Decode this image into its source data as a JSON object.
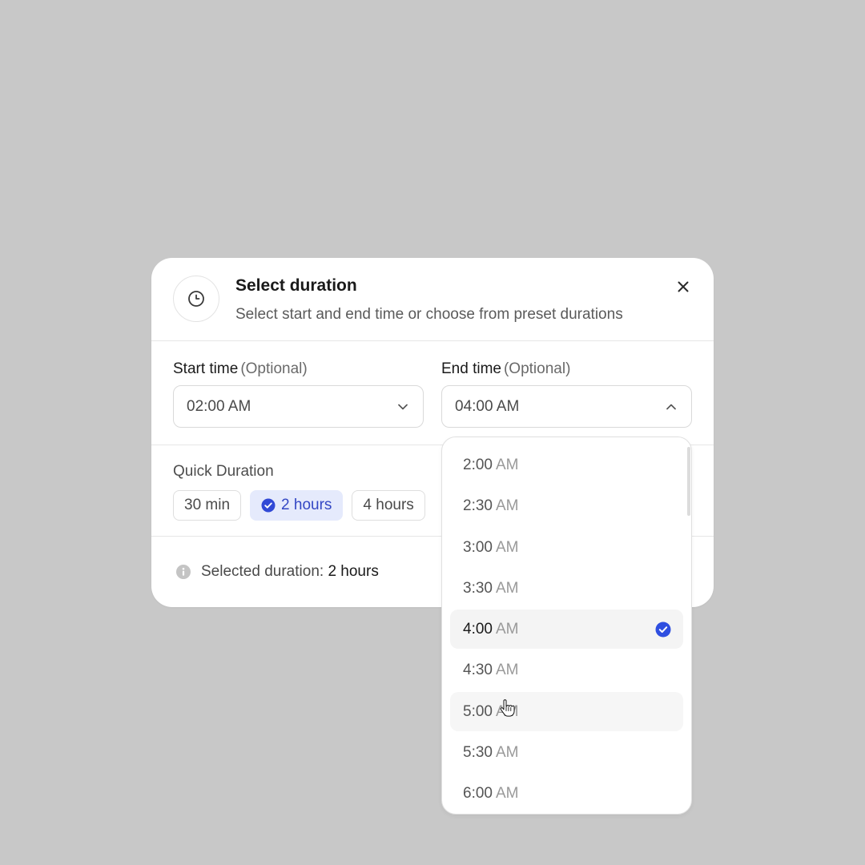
{
  "dialog": {
    "title": "Select duration",
    "subtitle": "Select start and end time or choose from preset durations",
    "header_icon": "clock-icon",
    "close_icon": "close-icon"
  },
  "start_time": {
    "label": "Start time",
    "optional": "(Optional)",
    "value": "02:00 AM",
    "icon": "chevron-down-icon"
  },
  "end_time": {
    "label": "End time",
    "optional": "(Optional)",
    "value": "04:00 AM",
    "icon": "chevron-up-icon",
    "open": true
  },
  "quick_duration": {
    "label": "Quick Duration",
    "chips": [
      {
        "label": "30 min",
        "selected": false
      },
      {
        "label": "2 hours",
        "selected": true
      },
      {
        "label": "4 hours",
        "selected": false
      }
    ]
  },
  "summary": {
    "prefix": "Selected duration:",
    "value": "2 hours",
    "icon": "info-icon"
  },
  "dropdown": {
    "items": [
      {
        "time": "2:00",
        "ampm": "AM"
      },
      {
        "time": "2:30",
        "ampm": "AM"
      },
      {
        "time": "3:00",
        "ampm": "AM"
      },
      {
        "time": "3:30",
        "ampm": "AM"
      },
      {
        "time": "4:00",
        "ampm": "AM"
      },
      {
        "time": "4:30",
        "ampm": "AM"
      },
      {
        "time": "5:00",
        "ampm": "AM"
      },
      {
        "time": "5:30",
        "ampm": "AM"
      },
      {
        "time": "6:00",
        "ampm": "AM"
      }
    ],
    "selected_index": 4,
    "hovered_index": 6
  },
  "colors": {
    "background": "#c8c8c8",
    "accent": "#3347c4",
    "accent_bg": "#e5eafc",
    "check": "#2f4fe0"
  }
}
